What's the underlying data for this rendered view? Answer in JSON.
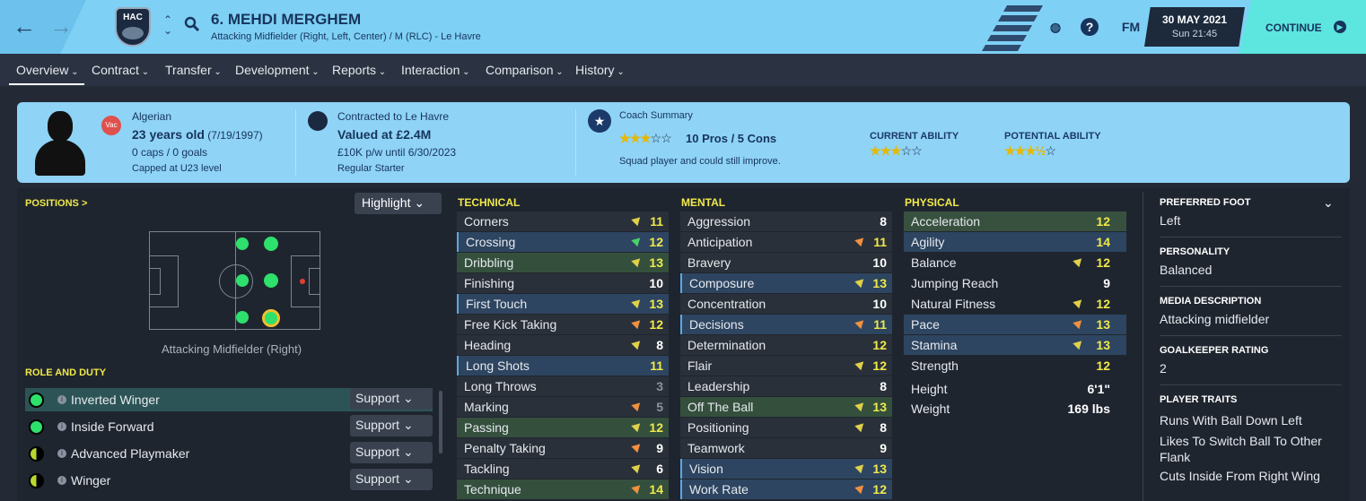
{
  "header": {
    "player_name": "6. MEHDI MERGHEM",
    "subtitle": "Attacking Midfielder (Right, Left, Center) / M (RLC) - Le Havre",
    "club_badge_text": "HAC",
    "date": "30 MAY 2021",
    "time": "Sun 21:45",
    "fm_label": "FM",
    "help_label": "?",
    "continue_label": "CONTINUE"
  },
  "tabs": [
    "Overview",
    "Contract",
    "Transfer",
    "Development",
    "Reports",
    "Interaction",
    "Comparison",
    "History"
  ],
  "summary": {
    "vac_label": "Vac",
    "nationality": "Algerian",
    "age": "23 years old",
    "dob": "(7/19/1997)",
    "caps": "0 caps / 0 goals",
    "capped": "Capped at U23 level",
    "contract": "Contracted to Le Havre",
    "value": "Valued at £2.4M",
    "wage": "£10K p/w until 6/30/2023",
    "status": "Regular Starter",
    "coach_label": "Coach Summary",
    "pros_cons": "10 Pros / 5 Cons",
    "coach_text": "Squad player and could still improve.",
    "ca_label": "CURRENT ABILITY",
    "pa_label": "POTENTIAL ABILITY",
    "coach_stars": 3,
    "ca_stars": 3,
    "pa_stars": 3.5
  },
  "positions": {
    "header": "POSITIONS >",
    "highlight": "Highlight",
    "label": "Attacking Midfielder (Right)"
  },
  "role_duty": {
    "header": "ROLE AND DUTY",
    "roles": [
      {
        "name": "Inverted Winger",
        "duty": "Support",
        "color": "#2ee06c"
      },
      {
        "name": "Inside Forward",
        "duty": "Support",
        "color": "#2ee06c"
      },
      {
        "name": "Advanced Playmaker",
        "duty": "Support",
        "color": "#b8d82e"
      },
      {
        "name": "Winger",
        "duty": "Support",
        "color": "#b8d82e"
      }
    ]
  },
  "technical": {
    "header": "TECHNICAL",
    "attrs": [
      {
        "name": "Corners",
        "value": "11"
      },
      {
        "name": "Crossing",
        "value": "12"
      },
      {
        "name": "Dribbling",
        "value": "13"
      },
      {
        "name": "Finishing",
        "value": "10"
      },
      {
        "name": "First Touch",
        "value": "13"
      },
      {
        "name": "Free Kick Taking",
        "value": "12"
      },
      {
        "name": "Heading",
        "value": "8"
      },
      {
        "name": "Long Shots",
        "value": "11"
      },
      {
        "name": "Long Throws",
        "value": "3"
      },
      {
        "name": "Marking",
        "value": "5"
      },
      {
        "name": "Passing",
        "value": "12"
      },
      {
        "name": "Penalty Taking",
        "value": "9"
      },
      {
        "name": "Tackling",
        "value": "6"
      },
      {
        "name": "Technique",
        "value": "14"
      }
    ]
  },
  "mental": {
    "header": "MENTAL",
    "attrs": [
      {
        "name": "Aggression",
        "value": "8"
      },
      {
        "name": "Anticipation",
        "value": "11"
      },
      {
        "name": "Bravery",
        "value": "10"
      },
      {
        "name": "Composure",
        "value": "13"
      },
      {
        "name": "Concentration",
        "value": "10"
      },
      {
        "name": "Decisions",
        "value": "11"
      },
      {
        "name": "Determination",
        "value": "12"
      },
      {
        "name": "Flair",
        "value": "12"
      },
      {
        "name": "Leadership",
        "value": "8"
      },
      {
        "name": "Off The Ball",
        "value": "13"
      },
      {
        "name": "Positioning",
        "value": "8"
      },
      {
        "name": "Teamwork",
        "value": "9"
      },
      {
        "name": "Vision",
        "value": "13"
      },
      {
        "name": "Work Rate",
        "value": "12"
      }
    ]
  },
  "physical": {
    "header": "PHYSICAL",
    "attrs": [
      {
        "name": "Acceleration",
        "value": "12"
      },
      {
        "name": "Agility",
        "value": "14"
      },
      {
        "name": "Balance",
        "value": "12"
      },
      {
        "name": "Jumping Reach",
        "value": "9"
      },
      {
        "name": "Natural Fitness",
        "value": "12"
      },
      {
        "name": "Pace",
        "value": "13"
      },
      {
        "name": "Stamina",
        "value": "13"
      },
      {
        "name": "Strength",
        "value": "12"
      }
    ],
    "height_label": "Height",
    "height": "6'1\"",
    "weight_label": "Weight",
    "weight": "169 lbs"
  },
  "info": {
    "foot_label": "PREFERRED FOOT",
    "foot": "Left",
    "personality_label": "PERSONALITY",
    "personality": "Balanced",
    "media_label": "MEDIA DESCRIPTION",
    "media": "Attacking midfielder",
    "gk_label": "GOALKEEPER RATING",
    "gk": "2",
    "traits_label": "PLAYER TRAITS",
    "traits": [
      "Runs With Ball Down Left",
      "Likes To Switch Ball To Other Flank",
      "Cuts Inside From Right Wing"
    ]
  },
  "colors": {
    "accent": "#7fd0f5",
    "continue": "#5de5e0",
    "highlight_yellow": "#f0e94a"
  }
}
